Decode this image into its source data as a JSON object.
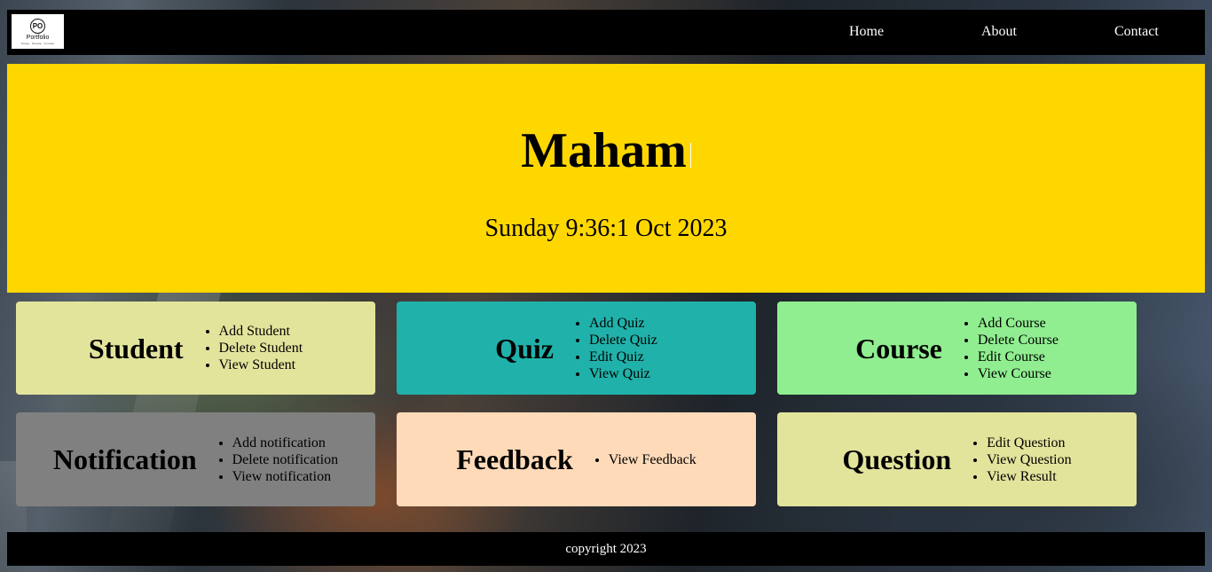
{
  "nav": {
    "logo_text": "Portfolio",
    "logo_mark": "PO",
    "logo_sub": "Design · Develop · Innovate",
    "links": [
      "Home",
      "About",
      "Contact"
    ]
  },
  "hero": {
    "name": "Maham",
    "datetime": "Sunday 9:36:1 Oct 2023"
  },
  "cards": [
    {
      "title": "Student",
      "items": [
        "Add Student",
        "Delete Student",
        "View Student"
      ],
      "color": "#e3e49c"
    },
    {
      "title": "Quiz",
      "items": [
        "Add Quiz",
        "Delete Quiz",
        "Edit Quiz",
        "View Quiz"
      ],
      "color": "#20b2aa"
    },
    {
      "title": "Course",
      "items": [
        "Add Course",
        "Delete Course",
        "Edit Course",
        "View Course"
      ],
      "color": "#90ee90"
    },
    {
      "title": "Notification",
      "items": [
        "Add notification",
        "Delete notification",
        "View notification"
      ],
      "color": "#808080"
    },
    {
      "title": "Feedback",
      "items": [
        "View Feedback"
      ],
      "color": "#ffdab9"
    },
    {
      "title": "Question",
      "items": [
        "Edit Question",
        "View Question",
        "View Result"
      ],
      "color": "#e3e49c"
    }
  ],
  "footer": {
    "text": "copyright 2023"
  },
  "colors": {
    "hero_bg": "#ffd700",
    "bar_bg": "#000000"
  }
}
